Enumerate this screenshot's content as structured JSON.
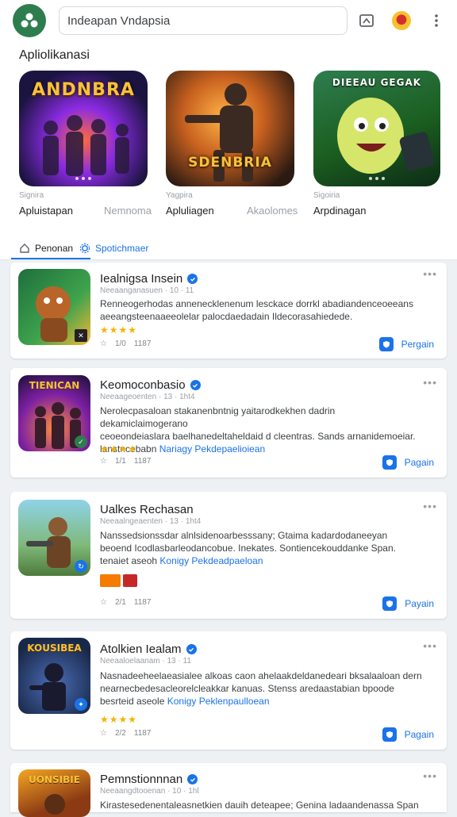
{
  "search": {
    "value": "Indeapan Vndapsia"
  },
  "featured": {
    "section_title": "Apliolikanasi",
    "tiles": [
      {
        "caption": "ANDNBRA",
        "subtitle": "Signira",
        "name": "Apluistapan",
        "alt": "Nemnoma"
      },
      {
        "caption": "SDENBRIA",
        "subtitle": "Yagpira",
        "name": "Apluliagen",
        "alt": "Akaolomes"
      },
      {
        "caption": "DIEEAU GEGAK",
        "subtitle": "Sigoiria",
        "name": "Arpdinagan",
        "alt": ""
      }
    ]
  },
  "tabs": {
    "first": "Penonan",
    "second": "Spotichmaer"
  },
  "colors": {
    "accent": "#1a73e8",
    "brand": "#2e7d4f",
    "star": "#f4b400"
  },
  "cards": [
    {
      "title": "Iealnigsa Insein",
      "meta": "Neeaanganasuen · 10 · 11",
      "desc_1": "Renneogerhodas annenecklenenum lesckace dorrkl abadiandenceoeeans",
      "desc_2": "aeeangsteenaaeeolelar palocdaedadain",
      "desc_link": "",
      "desc_3": "Ildecorasahiedede.",
      "stars": "★★★★",
      "stats_a": "1/0",
      "stats_b": "1187",
      "install": "Pergain",
      "thumb_caption": ""
    },
    {
      "title": "Keomoconbasio",
      "meta": "Neeaageoenten · 13 · 1ht4",
      "desc_1": "Nerolecpasaloan stakanenbntnig yaitarodkekhen dadrin dekamiclaimogerano",
      "desc_2": "ceoeondeiaslara baelhanedeltaheldaid d cleentras. Sands arnanidemoeiar.",
      "desc_3": "lanstncebabn",
      "desc_link": "Nariagy Pekdepaelioiean",
      "stars": "★★★★",
      "stats_a": "1/1",
      "stats_b": "1187",
      "install": "Pagain",
      "thumb_caption": "TIENICAN"
    },
    {
      "title": "Ualkes Rechasan",
      "meta": "Neeaalngeaenten · 13 · 1ht4",
      "desc_1": "Nanssedsionssdar alnlsidenoarbesssany; Gtaima kadardodaneeyan",
      "desc_2": "beoend Icodlasbarleodancobue. Inekates. Sontiencekouddanke Span.",
      "desc_3": "tenaiet aseoh",
      "desc_link": "Konigy Pekdeadpaeloan",
      "stars": "",
      "stats_a": "2/1",
      "stats_b": "1187",
      "install": "Payain",
      "thumb_caption": ""
    },
    {
      "title": "Atolkien Iealam",
      "meta": "Neeaaloelaanam · 13 · 11",
      "desc_1": "Nasnadeeheelaeasialee alkoas caon ahelaakdeldanedeari bksalaaloan dern",
      "desc_2": "nearnecbedesacleorelcleakkar kanuas. Stenss aredaastabian bpoode",
      "desc_3": "besrteid aseole",
      "desc_link": "Konigy Peklenpaulloean",
      "stars": "★★★★",
      "stats_a": "2/2",
      "stats_b": "1187",
      "install": "Pagain",
      "thumb_caption": "KOUSIBEA"
    },
    {
      "title": "Pemnstionnnan",
      "meta": "Neeaangdtooenan · 10 · 1hl",
      "desc_1": "Kirastesedenentaleasnetkien dauih deteapee; Genina ladaandenassa Span",
      "desc_2": "",
      "desc_3": "",
      "desc_link": "",
      "stars": "",
      "stats_a": "",
      "stats_b": "",
      "install": "",
      "thumb_caption": "UONSIBIE"
    }
  ]
}
